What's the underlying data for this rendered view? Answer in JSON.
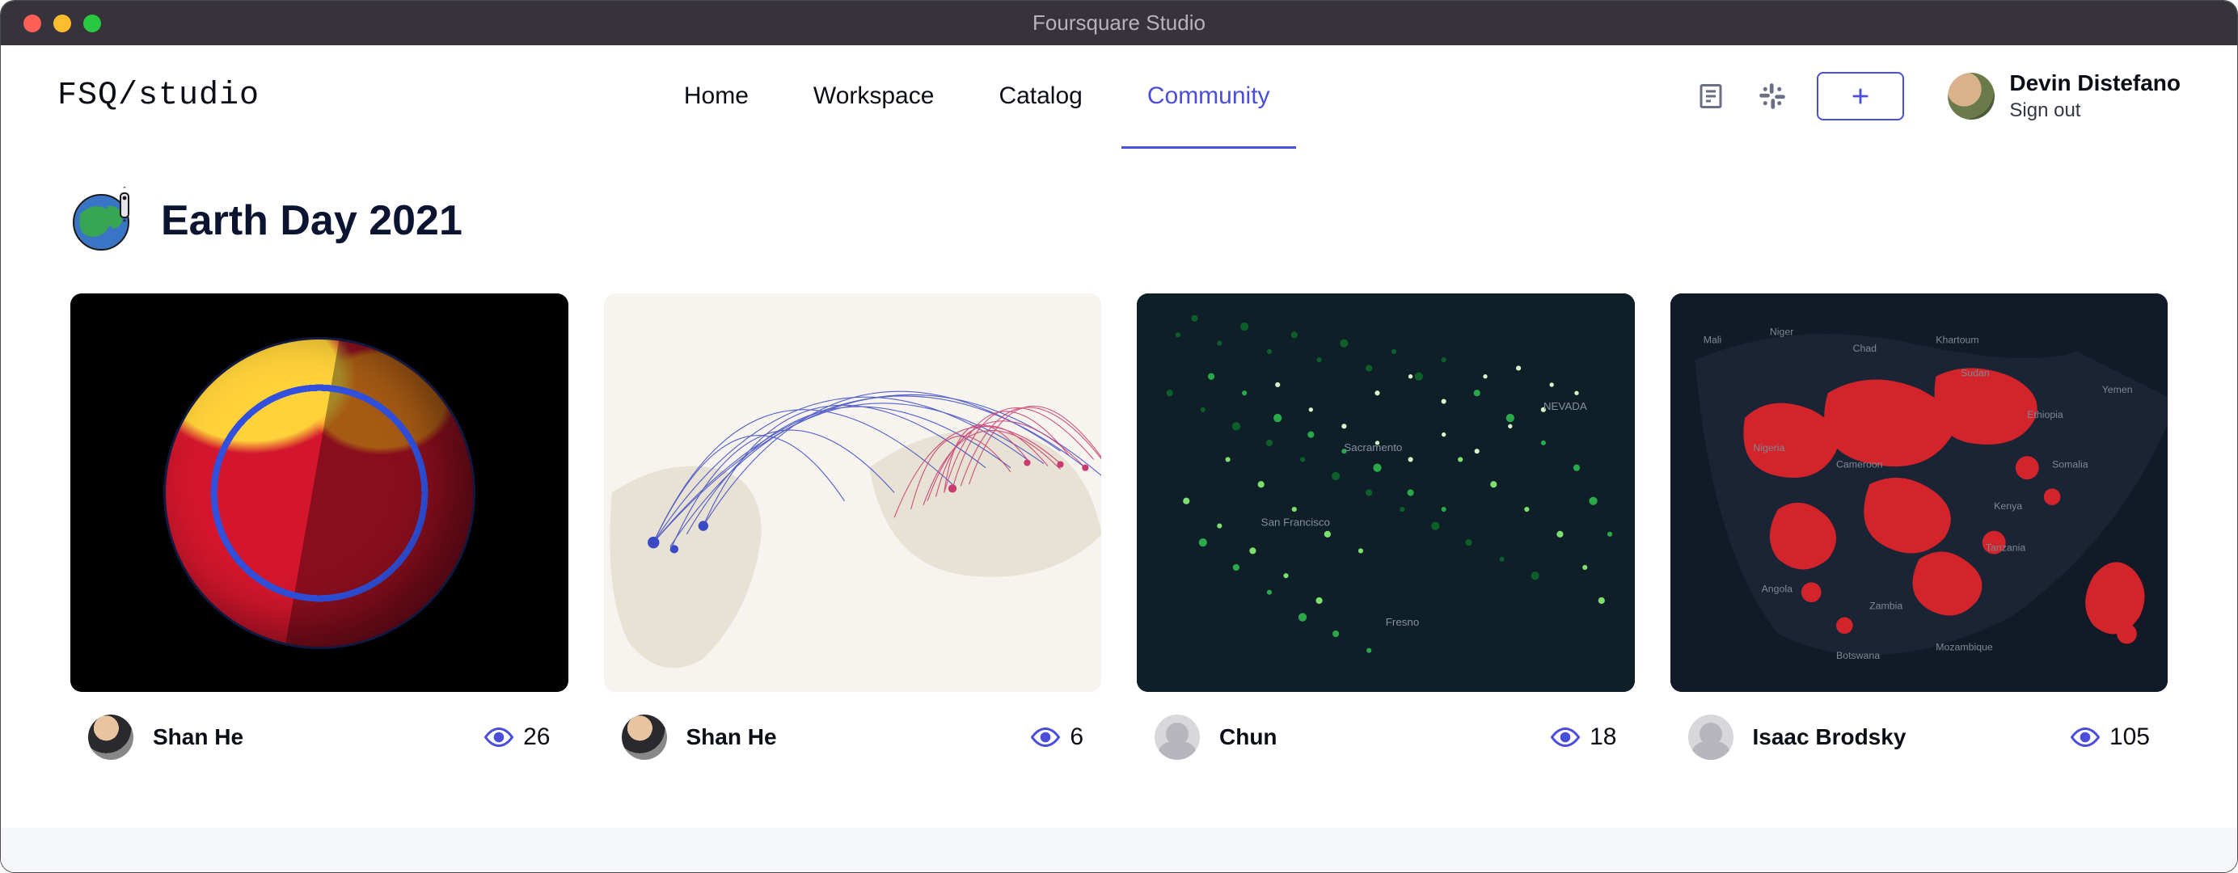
{
  "window": {
    "title": "Foursquare Studio"
  },
  "brand": {
    "logo_text": "FSQ/studio"
  },
  "nav": {
    "items": [
      {
        "label": "Home",
        "active": false
      },
      {
        "label": "Workspace",
        "active": false
      },
      {
        "label": "Catalog",
        "active": false
      },
      {
        "label": "Community",
        "active": true
      }
    ]
  },
  "user": {
    "name": "Devin Distefano",
    "signout_label": "Sign out"
  },
  "section": {
    "title": "Earth Day 2021"
  },
  "cards": [
    {
      "author": "Shan He",
      "views": "26",
      "avatar_kind": "photo",
      "thumb_kind": "globe"
    },
    {
      "author": "Shan He",
      "views": "6",
      "avatar_kind": "photo",
      "thumb_kind": "arcs"
    },
    {
      "author": "Chun",
      "views": "18",
      "avatar_kind": "gray",
      "thumb_kind": "green"
    },
    {
      "author": "Isaac Brodsky",
      "views": "105",
      "avatar_kind": "gray",
      "thumb_kind": "africa"
    }
  ]
}
